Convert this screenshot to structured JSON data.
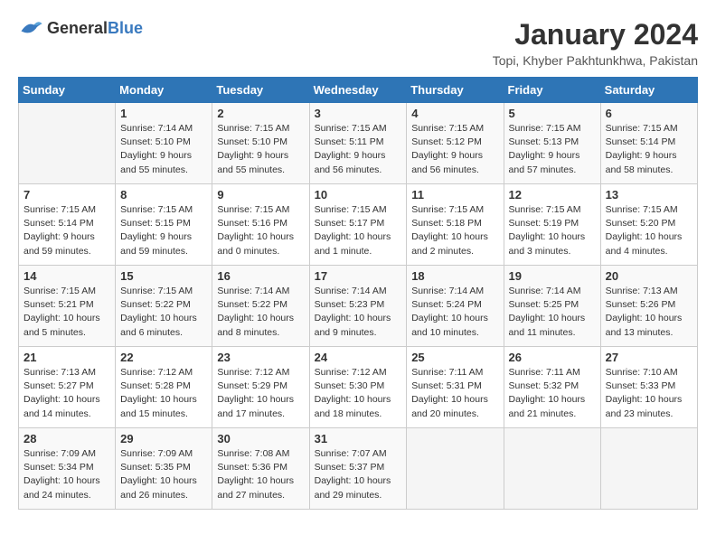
{
  "header": {
    "logo_general": "General",
    "logo_blue": "Blue",
    "month_year": "January 2024",
    "location": "Topi, Khyber Pakhtunkhwa, Pakistan"
  },
  "weekdays": [
    "Sunday",
    "Monday",
    "Tuesday",
    "Wednesday",
    "Thursday",
    "Friday",
    "Saturday"
  ],
  "weeks": [
    [
      {
        "day": "",
        "sunrise": "",
        "sunset": "",
        "daylight": ""
      },
      {
        "day": "1",
        "sunrise": "Sunrise: 7:14 AM",
        "sunset": "Sunset: 5:10 PM",
        "daylight": "Daylight: 9 hours and 55 minutes."
      },
      {
        "day": "2",
        "sunrise": "Sunrise: 7:15 AM",
        "sunset": "Sunset: 5:10 PM",
        "daylight": "Daylight: 9 hours and 55 minutes."
      },
      {
        "day": "3",
        "sunrise": "Sunrise: 7:15 AM",
        "sunset": "Sunset: 5:11 PM",
        "daylight": "Daylight: 9 hours and 56 minutes."
      },
      {
        "day": "4",
        "sunrise": "Sunrise: 7:15 AM",
        "sunset": "Sunset: 5:12 PM",
        "daylight": "Daylight: 9 hours and 56 minutes."
      },
      {
        "day": "5",
        "sunrise": "Sunrise: 7:15 AM",
        "sunset": "Sunset: 5:13 PM",
        "daylight": "Daylight: 9 hours and 57 minutes."
      },
      {
        "day": "6",
        "sunrise": "Sunrise: 7:15 AM",
        "sunset": "Sunset: 5:14 PM",
        "daylight": "Daylight: 9 hours and 58 minutes."
      }
    ],
    [
      {
        "day": "7",
        "sunrise": "Sunrise: 7:15 AM",
        "sunset": "Sunset: 5:14 PM",
        "daylight": "Daylight: 9 hours and 59 minutes."
      },
      {
        "day": "8",
        "sunrise": "Sunrise: 7:15 AM",
        "sunset": "Sunset: 5:15 PM",
        "daylight": "Daylight: 9 hours and 59 minutes."
      },
      {
        "day": "9",
        "sunrise": "Sunrise: 7:15 AM",
        "sunset": "Sunset: 5:16 PM",
        "daylight": "Daylight: 10 hours and 0 minutes."
      },
      {
        "day": "10",
        "sunrise": "Sunrise: 7:15 AM",
        "sunset": "Sunset: 5:17 PM",
        "daylight": "Daylight: 10 hours and 1 minute."
      },
      {
        "day": "11",
        "sunrise": "Sunrise: 7:15 AM",
        "sunset": "Sunset: 5:18 PM",
        "daylight": "Daylight: 10 hours and 2 minutes."
      },
      {
        "day": "12",
        "sunrise": "Sunrise: 7:15 AM",
        "sunset": "Sunset: 5:19 PM",
        "daylight": "Daylight: 10 hours and 3 minutes."
      },
      {
        "day": "13",
        "sunrise": "Sunrise: 7:15 AM",
        "sunset": "Sunset: 5:20 PM",
        "daylight": "Daylight: 10 hours and 4 minutes."
      }
    ],
    [
      {
        "day": "14",
        "sunrise": "Sunrise: 7:15 AM",
        "sunset": "Sunset: 5:21 PM",
        "daylight": "Daylight: 10 hours and 5 minutes."
      },
      {
        "day": "15",
        "sunrise": "Sunrise: 7:15 AM",
        "sunset": "Sunset: 5:22 PM",
        "daylight": "Daylight: 10 hours and 6 minutes."
      },
      {
        "day": "16",
        "sunrise": "Sunrise: 7:14 AM",
        "sunset": "Sunset: 5:22 PM",
        "daylight": "Daylight: 10 hours and 8 minutes."
      },
      {
        "day": "17",
        "sunrise": "Sunrise: 7:14 AM",
        "sunset": "Sunset: 5:23 PM",
        "daylight": "Daylight: 10 hours and 9 minutes."
      },
      {
        "day": "18",
        "sunrise": "Sunrise: 7:14 AM",
        "sunset": "Sunset: 5:24 PM",
        "daylight": "Daylight: 10 hours and 10 minutes."
      },
      {
        "day": "19",
        "sunrise": "Sunrise: 7:14 AM",
        "sunset": "Sunset: 5:25 PM",
        "daylight": "Daylight: 10 hours and 11 minutes."
      },
      {
        "day": "20",
        "sunrise": "Sunrise: 7:13 AM",
        "sunset": "Sunset: 5:26 PM",
        "daylight": "Daylight: 10 hours and 13 minutes."
      }
    ],
    [
      {
        "day": "21",
        "sunrise": "Sunrise: 7:13 AM",
        "sunset": "Sunset: 5:27 PM",
        "daylight": "Daylight: 10 hours and 14 minutes."
      },
      {
        "day": "22",
        "sunrise": "Sunrise: 7:12 AM",
        "sunset": "Sunset: 5:28 PM",
        "daylight": "Daylight: 10 hours and 15 minutes."
      },
      {
        "day": "23",
        "sunrise": "Sunrise: 7:12 AM",
        "sunset": "Sunset: 5:29 PM",
        "daylight": "Daylight: 10 hours and 17 minutes."
      },
      {
        "day": "24",
        "sunrise": "Sunrise: 7:12 AM",
        "sunset": "Sunset: 5:30 PM",
        "daylight": "Daylight: 10 hours and 18 minutes."
      },
      {
        "day": "25",
        "sunrise": "Sunrise: 7:11 AM",
        "sunset": "Sunset: 5:31 PM",
        "daylight": "Daylight: 10 hours and 20 minutes."
      },
      {
        "day": "26",
        "sunrise": "Sunrise: 7:11 AM",
        "sunset": "Sunset: 5:32 PM",
        "daylight": "Daylight: 10 hours and 21 minutes."
      },
      {
        "day": "27",
        "sunrise": "Sunrise: 7:10 AM",
        "sunset": "Sunset: 5:33 PM",
        "daylight": "Daylight: 10 hours and 23 minutes."
      }
    ],
    [
      {
        "day": "28",
        "sunrise": "Sunrise: 7:09 AM",
        "sunset": "Sunset: 5:34 PM",
        "daylight": "Daylight: 10 hours and 24 minutes."
      },
      {
        "day": "29",
        "sunrise": "Sunrise: 7:09 AM",
        "sunset": "Sunset: 5:35 PM",
        "daylight": "Daylight: 10 hours and 26 minutes."
      },
      {
        "day": "30",
        "sunrise": "Sunrise: 7:08 AM",
        "sunset": "Sunset: 5:36 PM",
        "daylight": "Daylight: 10 hours and 27 minutes."
      },
      {
        "day": "31",
        "sunrise": "Sunrise: 7:07 AM",
        "sunset": "Sunset: 5:37 PM",
        "daylight": "Daylight: 10 hours and 29 minutes."
      },
      {
        "day": "",
        "sunrise": "",
        "sunset": "",
        "daylight": ""
      },
      {
        "day": "",
        "sunrise": "",
        "sunset": "",
        "daylight": ""
      },
      {
        "day": "",
        "sunrise": "",
        "sunset": "",
        "daylight": ""
      }
    ]
  ]
}
